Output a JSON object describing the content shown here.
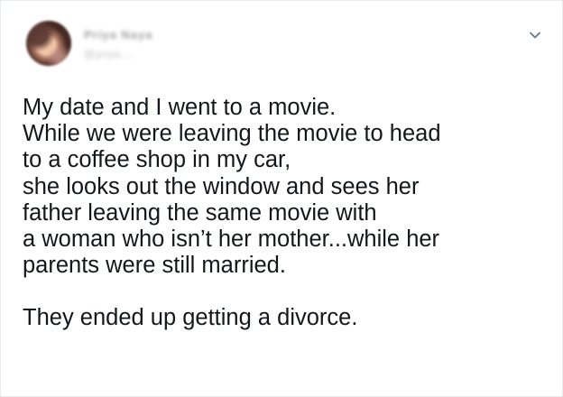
{
  "author": {
    "display_name": "Priya Naya",
    "handle": "@prya..."
  },
  "icons": {
    "avatar": "avatar",
    "menu": "chevron-down-icon"
  },
  "tweet": {
    "lines": [
      "My date and I went to a movie.",
      "While we were leaving the movie to head",
      "to a coffee shop in my car,",
      "she looks out the window and sees her",
      "father leaving the same movie with",
      "a woman who isn’t her mother...while her",
      "parents were still married.",
      "They ended up getting a divorce."
    ]
  },
  "colors": {
    "text": "#14171a",
    "border": "#e6ecf0",
    "icon": "#657786"
  }
}
